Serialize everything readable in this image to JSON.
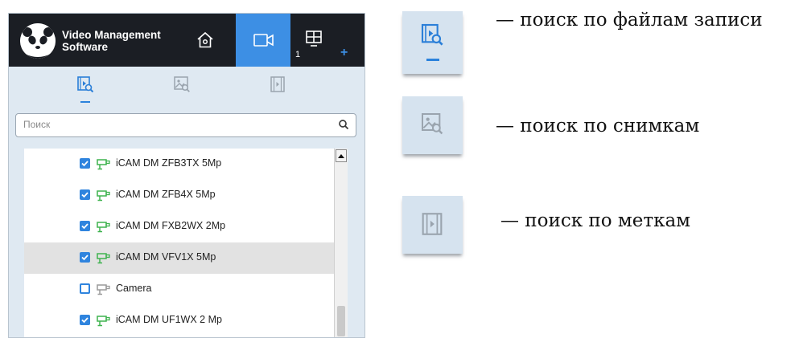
{
  "app": {
    "title_line1": "Video Management",
    "title_line2": "Software",
    "layout_count": "1",
    "layout_add": "+"
  },
  "nav": [
    {
      "name": "home-icon",
      "active": false
    },
    {
      "name": "live-view-icon",
      "active": true
    },
    {
      "name": "layout-icon",
      "active": false
    }
  ],
  "tabs": [
    {
      "name": "recording-search-icon",
      "active": true
    },
    {
      "name": "snapshot-search-icon",
      "active": false
    },
    {
      "name": "tag-search-icon",
      "active": false
    }
  ],
  "search": {
    "placeholder": "Поиск"
  },
  "cameras": [
    {
      "label": "iCAM DM ZFB3TX 5Mp",
      "checked": true,
      "online": true,
      "selected": false
    },
    {
      "label": "iCAM DM ZFB4X 5Mp",
      "checked": true,
      "online": true,
      "selected": false
    },
    {
      "label": "iCAM DM FXB2WX 2Mp",
      "checked": true,
      "online": true,
      "selected": false
    },
    {
      "label": "iCAM DM VFV1X 5Mp",
      "checked": true,
      "online": true,
      "selected": true
    },
    {
      "label": "Camera",
      "checked": false,
      "online": false,
      "selected": false
    },
    {
      "label": "iCAM DM UF1WX 2 Mp",
      "checked": true,
      "online": true,
      "selected": false
    }
  ],
  "legend": [
    {
      "icon": "recording-search-icon",
      "text": "— поиск по файлам записи"
    },
    {
      "icon": "snapshot-search-icon",
      "text": "— поиск по снимкам"
    },
    {
      "icon": "tag-search-icon",
      "text": "— поиск по меткам"
    }
  ],
  "colors": {
    "accent": "#3d8fe4",
    "topbar": "#1b1e24",
    "panel": "#dfe9f2",
    "camera_online": "#3fb34f",
    "camera_offline": "#9a9a9a",
    "checkbox": "#2f84de"
  }
}
